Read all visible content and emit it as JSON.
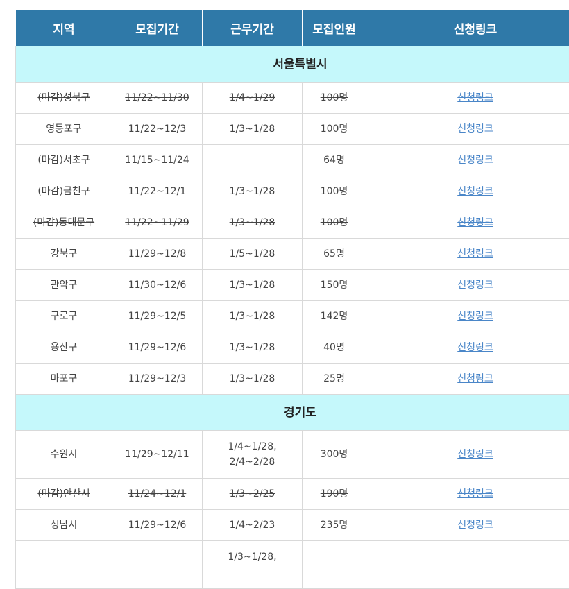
{
  "header": {
    "region": "지역",
    "recruit_period": "모집기간",
    "work_period": "근무기간",
    "headcount": "모집인원",
    "link": "신청링크"
  },
  "sections": [
    {
      "title": "서울특별시",
      "rows": [
        {
          "region": "(마감)성북구",
          "recruit": "11/22~11/30",
          "work": [
            "1/4~1/29"
          ],
          "count": "100명",
          "link": "신청링크",
          "closed": true
        },
        {
          "region": "영등포구",
          "recruit": "11/22~12/3",
          "work": [
            "1/3~1/28"
          ],
          "count": "100명",
          "link": "신청링크",
          "closed": false
        },
        {
          "region": "(마감)서초구",
          "recruit": "11/15~11/24",
          "work": [],
          "count": "64명",
          "link": "신청링크",
          "closed": true
        },
        {
          "region": "(마감)금천구",
          "recruit": "11/22~12/1",
          "work": [
            "1/3~1/28"
          ],
          "count": "100명",
          "link": "신청링크",
          "closed": true
        },
        {
          "region": "(마감)동대문구",
          "recruit": "11/22~11/29",
          "work": [
            "1/3~1/28"
          ],
          "count": "100명",
          "link": "신청링크",
          "closed": true
        },
        {
          "region": "강북구",
          "recruit": "11/29~12/8",
          "work": [
            "1/5~1/28"
          ],
          "count": "65명",
          "link": "신청링크",
          "closed": false
        },
        {
          "region": "관악구",
          "recruit": "11/30~12/6",
          "work": [
            "1/3~1/28"
          ],
          "count": "150명",
          "link": "신청링크",
          "closed": false
        },
        {
          "region": "구로구",
          "recruit": "11/29~12/5",
          "work": [
            "1/3~1/28"
          ],
          "count": "142명",
          "link": "신청링크",
          "closed": false
        },
        {
          "region": "용산구",
          "recruit": "11/29~12/6",
          "work": [
            "1/3~1/28"
          ],
          "count": "40명",
          "link": "신청링크",
          "closed": false
        },
        {
          "region": "마포구",
          "recruit": "11/29~12/3",
          "work": [
            "1/3~1/28"
          ],
          "count": "25명",
          "link": "신청링크",
          "closed": false
        }
      ]
    },
    {
      "title": "경기도",
      "rows": [
        {
          "region": "수원시",
          "recruit": "11/29~12/11",
          "work": [
            "1/4~1/28,",
            "2/4~2/28"
          ],
          "count": "300명",
          "link": "신청링크",
          "closed": false
        },
        {
          "region": "(마감)안산시",
          "recruit": "11/24~12/1",
          "work": [
            "1/3~2/25"
          ],
          "count": "190명",
          "link": "신청링크",
          "closed": true
        },
        {
          "region": "성남시",
          "recruit": "11/29~12/6",
          "work": [
            "1/4~2/23"
          ],
          "count": "235명",
          "link": "신청링크",
          "closed": false
        },
        {
          "region": "",
          "recruit": "",
          "work": [
            "1/3~1/28,",
            ""
          ],
          "count": "",
          "link": "",
          "closed": false
        }
      ]
    }
  ]
}
